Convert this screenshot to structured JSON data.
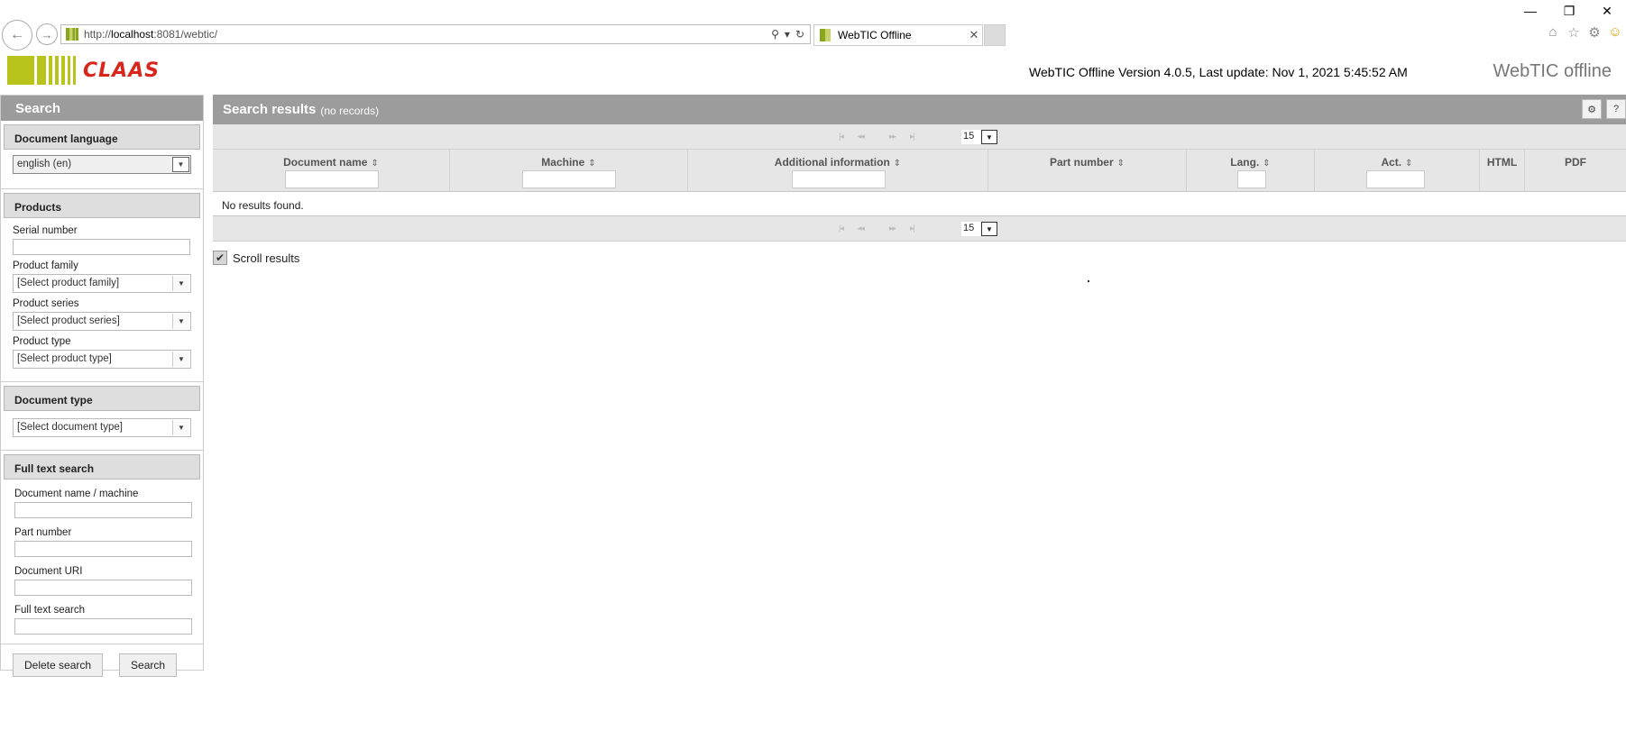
{
  "browser": {
    "url_prefix": "http://",
    "url_host": "localhost",
    "url_rest": ":8081/webtic/",
    "tab_title": "WebTIC Offline",
    "tab_close": "✕",
    "back_glyph": "←",
    "forward_glyph": "→",
    "search_glyph": "⚲",
    "dropdown_glyph": "▾",
    "refresh_glyph": "↻",
    "minimize_glyph": "—",
    "restore_glyph": "❐",
    "close_glyph": "✕",
    "home_glyph": "⌂",
    "favorites_glyph": "☆",
    "settings_glyph": "⚙",
    "feedback_glyph": "☺"
  },
  "header": {
    "logo_text": "CLAAS",
    "version_text": "WebTIC Offline Version 4.0.5, Last update: Nov 1, 2021 5:45:52 AM",
    "brand_right": "WebTIC offline",
    "brand_color": "#b8c41c",
    "logo_text_color": "#d9261c"
  },
  "search_panel": {
    "title": "Search",
    "language": {
      "heading": "Document language",
      "selected": "english (en)"
    },
    "products": {
      "heading": "Products",
      "serial_label": "Serial number",
      "family_label": "Product family",
      "family_placeholder": "[Select product family]",
      "series_label": "Product series",
      "series_placeholder": "[Select product series]",
      "type_label": "Product type",
      "type_placeholder": "[Select product type]"
    },
    "document_type": {
      "heading": "Document type",
      "placeholder": "[Select document type]"
    },
    "full_text": {
      "heading": "Full text search",
      "docname_label": "Document name / machine",
      "partnumber_label": "Part number",
      "uri_label": "Document URI",
      "fulltext_label": "Full text search"
    },
    "delete_button": "Delete search",
    "search_button": "Search"
  },
  "results": {
    "title": "Search results",
    "subtitle": "(no records)",
    "settings_glyph": "⚙",
    "help_glyph": "?",
    "pager_first": "|◂",
    "pager_prev": "◂◂",
    "pager_next": "▸▸",
    "pager_last": "▸|",
    "page_size": "15",
    "sort_glyph": "⇕",
    "columns": {
      "docname": "Document name",
      "machine": "Machine",
      "additional": "Additional information",
      "partnumber": "Part number",
      "lang": "Lang.",
      "act": "Act.",
      "html": "HTML",
      "pdf": "PDF"
    },
    "empty_message": "No results found.",
    "scroll_label": "Scroll results",
    "check_glyph": "✔"
  }
}
